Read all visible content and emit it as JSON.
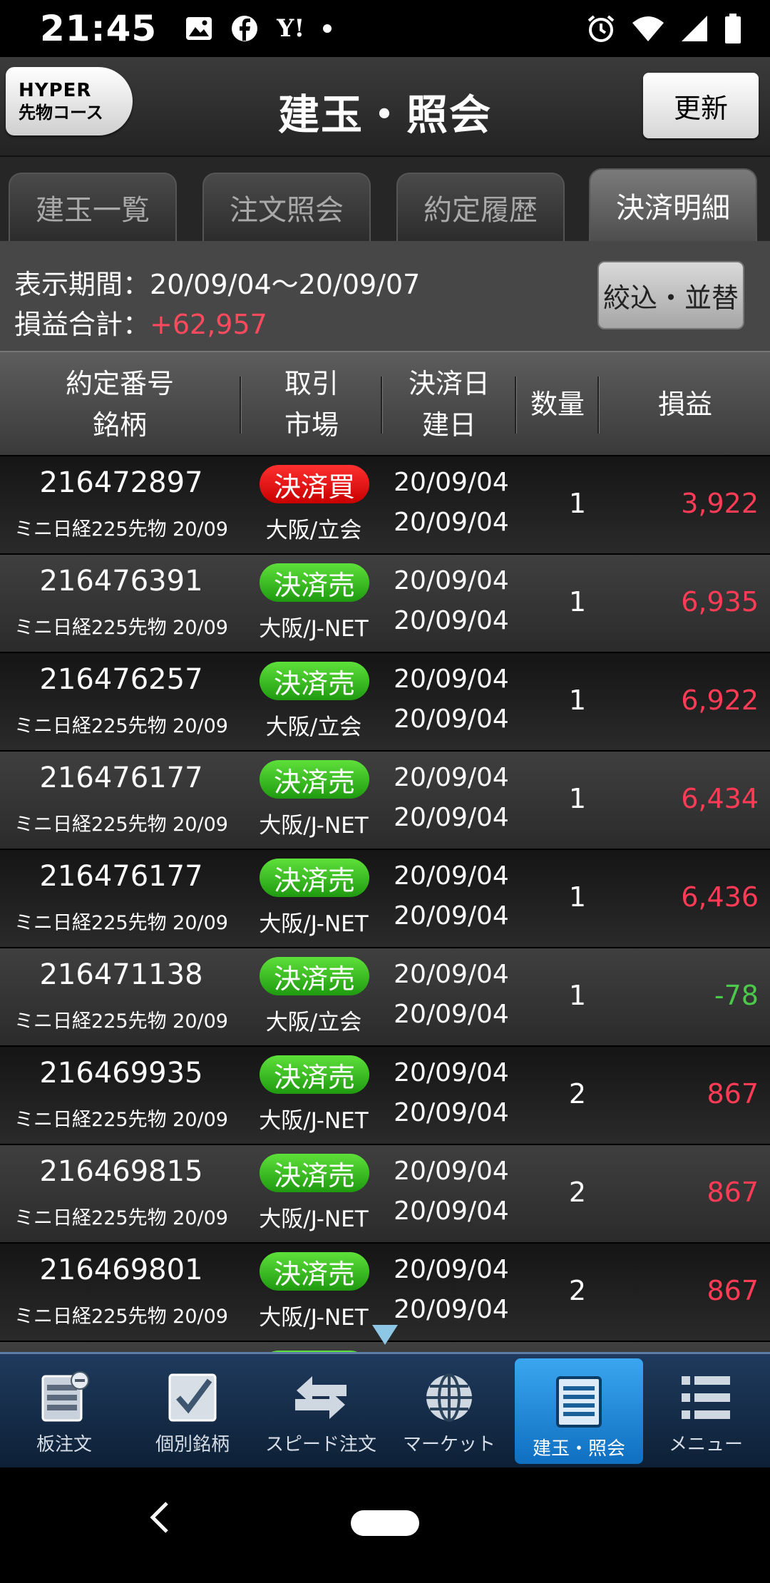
{
  "status_bar": {
    "time": "21:45",
    "left_icons": [
      "image-icon",
      "facebook-icon",
      "yahoo-icon",
      "dot-icon"
    ],
    "right_icons": [
      "alarm-icon",
      "wifi-icon",
      "signal-icon",
      "battery-icon"
    ],
    "yahoo_text": "Y!"
  },
  "header": {
    "course_line1": "HYPER",
    "course_line2": "先物コース",
    "title": "建玉・照会",
    "refresh_label": "更新"
  },
  "tabs": [
    {
      "label": "建玉一覧",
      "active": false
    },
    {
      "label": "注文照会",
      "active": false
    },
    {
      "label": "約定履歴",
      "active": false
    },
    {
      "label": "決済明細",
      "active": true
    }
  ],
  "summary": {
    "period_label": "表示期間：",
    "period_value": "20/09/04〜20/09/07",
    "pl_label": "損益合計：",
    "pl_value": "+62,957",
    "filter_label": "絞込・並替"
  },
  "columns": {
    "order_no": "約定番号",
    "symbol": "銘柄",
    "trade": "取引",
    "market": "市場",
    "settle_date": "決済日",
    "open_date": "建日",
    "qty": "数量",
    "pl": "損益"
  },
  "rows": [
    {
      "order_no": "216472897",
      "symbol": "ミニ日経225先物 20/09",
      "side": "決済買",
      "side_type": "buy",
      "market": "大阪/立会",
      "settle_date": "20/09/04",
      "open_date": "20/09/04",
      "qty": "1",
      "pl": "3,922",
      "pl_sign": "pos"
    },
    {
      "order_no": "216476391",
      "symbol": "ミニ日経225先物 20/09",
      "side": "決済売",
      "side_type": "sell",
      "market": "大阪/J-NET",
      "settle_date": "20/09/04",
      "open_date": "20/09/04",
      "qty": "1",
      "pl": "6,935",
      "pl_sign": "pos"
    },
    {
      "order_no": "216476257",
      "symbol": "ミニ日経225先物 20/09",
      "side": "決済売",
      "side_type": "sell",
      "market": "大阪/立会",
      "settle_date": "20/09/04",
      "open_date": "20/09/04",
      "qty": "1",
      "pl": "6,922",
      "pl_sign": "pos"
    },
    {
      "order_no": "216476177",
      "symbol": "ミニ日経225先物 20/09",
      "side": "決済売",
      "side_type": "sell",
      "market": "大阪/J-NET",
      "settle_date": "20/09/04",
      "open_date": "20/09/04",
      "qty": "1",
      "pl": "6,434",
      "pl_sign": "pos"
    },
    {
      "order_no": "216476177",
      "symbol": "ミニ日経225先物 20/09",
      "side": "決済売",
      "side_type": "sell",
      "market": "大阪/J-NET",
      "settle_date": "20/09/04",
      "open_date": "20/09/04",
      "qty": "1",
      "pl": "6,436",
      "pl_sign": "pos"
    },
    {
      "order_no": "216471138",
      "symbol": "ミニ日経225先物 20/09",
      "side": "決済売",
      "side_type": "sell",
      "market": "大阪/立会",
      "settle_date": "20/09/04",
      "open_date": "20/09/04",
      "qty": "1",
      "pl": "-78",
      "pl_sign": "neg"
    },
    {
      "order_no": "216469935",
      "symbol": "ミニ日経225先物 20/09",
      "side": "決済売",
      "side_type": "sell",
      "market": "大阪/J-NET",
      "settle_date": "20/09/04",
      "open_date": "20/09/04",
      "qty": "2",
      "pl": "867",
      "pl_sign": "pos"
    },
    {
      "order_no": "216469815",
      "symbol": "ミニ日経225先物 20/09",
      "side": "決済売",
      "side_type": "sell",
      "market": "大阪/J-NET",
      "settle_date": "20/09/04",
      "open_date": "20/09/04",
      "qty": "2",
      "pl": "867",
      "pl_sign": "pos"
    },
    {
      "order_no": "216469801",
      "symbol": "ミニ日経225先物 20/09",
      "side": "決済売",
      "side_type": "sell",
      "market": "大阪/J-NET",
      "settle_date": "20/09/04",
      "open_date": "20/09/04",
      "qty": "2",
      "pl": "867",
      "pl_sign": "pos"
    }
  ],
  "bottom_nav": [
    {
      "label": "板注文",
      "icon": "order-board-icon",
      "active": false
    },
    {
      "label": "個別銘柄",
      "icon": "checkbox-icon",
      "active": false
    },
    {
      "label": "スピード注文",
      "icon": "exchange-arrows-icon",
      "active": false
    },
    {
      "label": "マーケット",
      "icon": "globe-icon",
      "active": false
    },
    {
      "label": "建玉・照会",
      "icon": "list-document-icon",
      "active": true
    },
    {
      "label": "メニュー",
      "icon": "menu-list-icon",
      "active": false
    }
  ],
  "colors": {
    "profit": "#ff3b56",
    "loss": "#4cc84a",
    "buy_badge": "#e00000",
    "sell_badge": "#2cb51c",
    "nav_active": "#1f86d6"
  }
}
